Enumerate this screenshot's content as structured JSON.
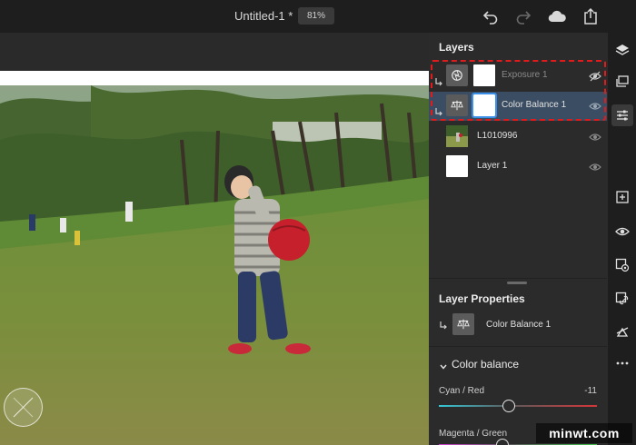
{
  "header": {
    "doc_title": "Untitled-1 *",
    "zoom": "81%",
    "icons": [
      "undo-icon",
      "redo-icon",
      "cloud-icon",
      "share-icon"
    ]
  },
  "layers_panel": {
    "title": "Layers",
    "layers": [
      {
        "name": "Exposure 1",
        "type": "adjustment",
        "visible": false,
        "clipped": true,
        "selected": false
      },
      {
        "name": "Color Balance 1",
        "type": "adjustment",
        "visible": true,
        "clipped": true,
        "selected": true
      },
      {
        "name": "L1010996",
        "type": "image",
        "visible": true,
        "clipped": false,
        "selected": false
      },
      {
        "name": "Layer 1",
        "type": "pixel",
        "visible": true,
        "clipped": false,
        "selected": false
      }
    ]
  },
  "layer_properties": {
    "title": "Layer Properties",
    "layer_name": "Color Balance 1"
  },
  "color_balance": {
    "title": "Color balance",
    "sliders": [
      {
        "label": "Cyan / Red",
        "value": "-11",
        "fraction": 0.445
      },
      {
        "label": "Magenta / Green",
        "value": "",
        "fraction": 0.4
      }
    ]
  },
  "right_toolbar": {
    "icons": [
      "layers-icon",
      "layer-stack-icon",
      "adjustments-icon",
      "add-layer-icon",
      "visibility-icon",
      "mask-visibility-icon",
      "link-icon",
      "clip-icon",
      "more-icon"
    ]
  },
  "watermark": "minwt.com",
  "colors": {
    "accent": "#3a8fe8",
    "selected_row": "#3b4d62",
    "annotation": "#e11b1b"
  }
}
